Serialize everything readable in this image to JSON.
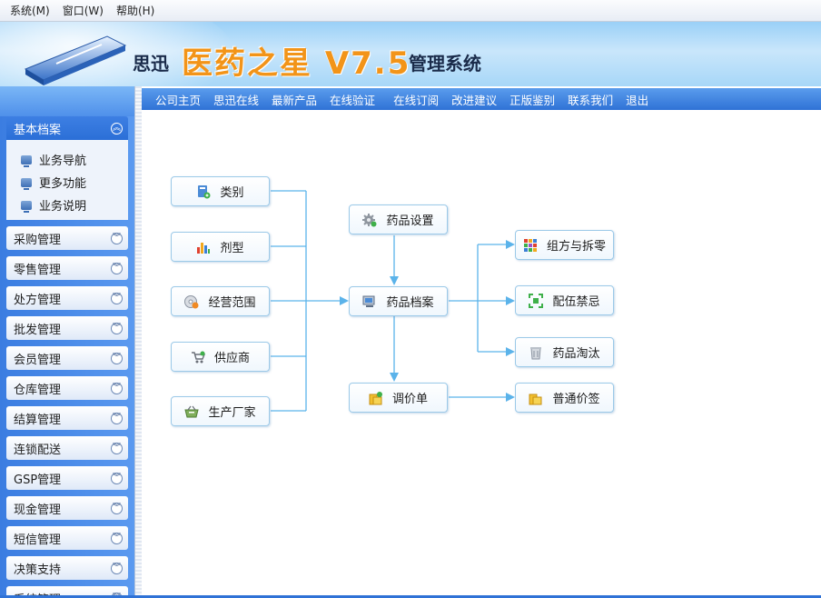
{
  "menubar": {
    "items": [
      "系统(M)",
      "窗口(W)",
      "帮助(H)"
    ]
  },
  "banner": {
    "company": "思迅",
    "product": "医药之星 V7.5",
    "suffix": "管理系统"
  },
  "sidebar": {
    "active_group": {
      "label": "基本档案",
      "items": [
        "业务导航",
        "更多功能",
        "业务说明"
      ]
    },
    "groups": [
      "采购管理",
      "零售管理",
      "处方管理",
      "批发管理",
      "会员管理",
      "仓库管理",
      "结算管理",
      "连锁配送",
      "GSP管理",
      "现金管理",
      "短信管理",
      "决策支持",
      "系统管理"
    ]
  },
  "navbar": {
    "links": [
      "公司主页",
      "思迅在线",
      "最新产品",
      "在线验证",
      "在线订阅",
      "改进建议",
      "正版鉴别",
      "联系我们",
      "退出"
    ]
  },
  "flow": {
    "left": [
      {
        "label": "类别",
        "icon": "category-icon"
      },
      {
        "label": "剂型",
        "icon": "bar-chart-icon"
      },
      {
        "label": "经营范围",
        "icon": "disc-icon"
      },
      {
        "label": "供应商",
        "icon": "cart-icon"
      },
      {
        "label": "生产厂家",
        "icon": "basket-icon"
      }
    ],
    "center": [
      {
        "label": "药品设置",
        "icon": "gear-icon"
      },
      {
        "label": "药品档案",
        "icon": "computer-icon"
      },
      {
        "label": "调价单",
        "icon": "coins-icon"
      }
    ],
    "right": [
      {
        "label": "组方与拆零",
        "icon": "grid-icon"
      },
      {
        "label": "配伍禁忌",
        "icon": "frame-icon"
      },
      {
        "label": "药品淘汰",
        "icon": "trash-icon"
      },
      {
        "label": "普通价签",
        "icon": "coins-icon"
      }
    ]
  }
}
